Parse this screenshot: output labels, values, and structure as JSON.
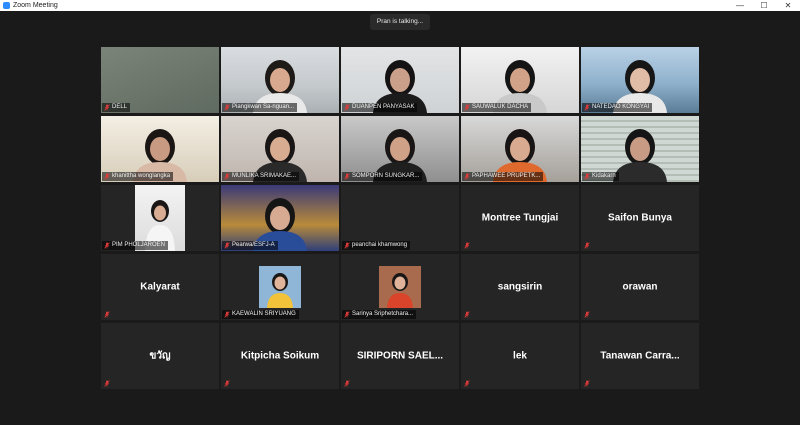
{
  "window": {
    "title": "Zoom Meeting",
    "controls": [
      "—",
      "☐",
      "✕"
    ]
  },
  "speaker_banner": "Pran is talking...",
  "mic_icon": "mic-muted-icon",
  "muted_color": "#e03b3b",
  "tiles": [
    {
      "name": "DELL",
      "kind": "video",
      "scene": "blank"
    },
    {
      "name": "Piangkwan Sa-nguan...",
      "kind": "video",
      "scene": "woman-office"
    },
    {
      "name": "DUANPEN PANYASAK",
      "kind": "video",
      "scene": "woman-desk"
    },
    {
      "name": "SAUWALUK DACHA",
      "kind": "video",
      "scene": "woman-headset"
    },
    {
      "name": "NATEDAO KONGYAI",
      "kind": "video",
      "scene": "woman-sea"
    },
    {
      "name": "khanittha wonglangka",
      "kind": "video",
      "scene": "woman-window"
    },
    {
      "name": "MUNLIKA SRIMAKAE...",
      "kind": "video",
      "scene": "woman-glasses"
    },
    {
      "name": "SOMPORN SUNGKAR...",
      "kind": "video",
      "scene": "woman-room"
    },
    {
      "name": "PAPHAWEE PRUPETK...",
      "kind": "video",
      "scene": "woman-orange"
    },
    {
      "name": "Kidakarn",
      "kind": "video",
      "scene": "blinds"
    },
    {
      "name": "PIM PHOLJAROEN",
      "kind": "video",
      "scene": "small-portrait"
    },
    {
      "name": "Pearwa/ESFJ-A",
      "kind": "video",
      "scene": "royal"
    },
    {
      "name": "peanchai khamwong",
      "kind": "empty"
    },
    {
      "name": "Montree Tungjai",
      "kind": "name"
    },
    {
      "name": "Saifon Bunya",
      "kind": "name"
    },
    {
      "name": "Kalyarat",
      "kind": "name"
    },
    {
      "name": "KAEWALIN SRIYUANG",
      "kind": "avatar",
      "scene": "avatar-blue"
    },
    {
      "name": "Sarinya Sriphetchara...",
      "kind": "avatar",
      "scene": "avatar-red"
    },
    {
      "name": "sangsirin",
      "kind": "name"
    },
    {
      "name": "orawan",
      "kind": "name"
    },
    {
      "name": "ขวัญ",
      "kind": "name"
    },
    {
      "name": "Kitpicha Soikum",
      "kind": "name"
    },
    {
      "name": "SIRIPORN SAEL...",
      "kind": "name"
    },
    {
      "name": "lek",
      "kind": "name"
    },
    {
      "name": "Tanawan Carra...",
      "kind": "name"
    }
  ]
}
